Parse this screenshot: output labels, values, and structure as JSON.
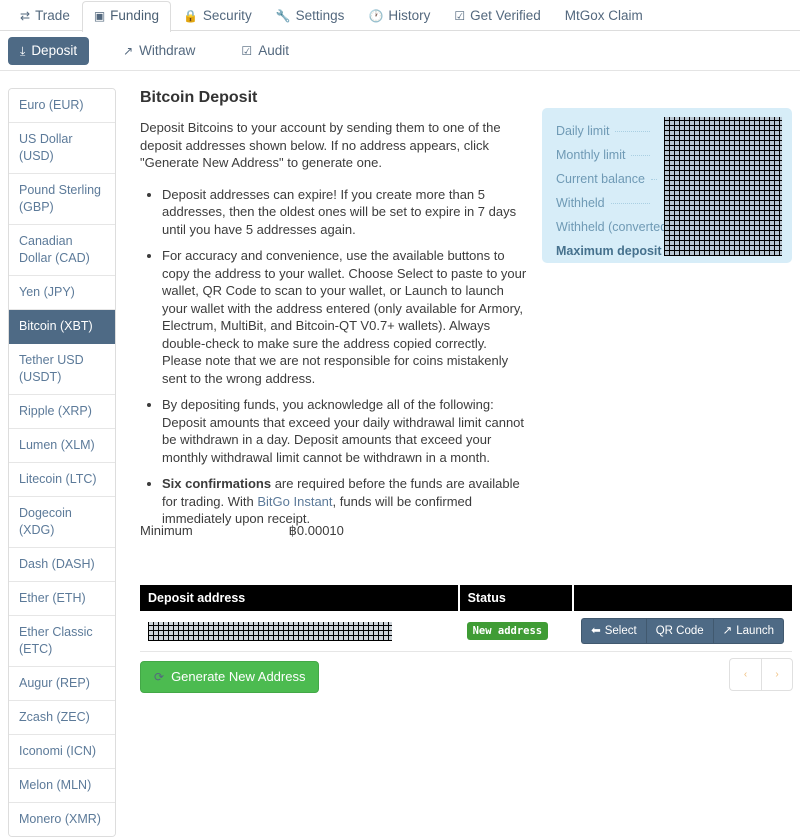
{
  "nav": {
    "tabs": [
      {
        "label": "Trade",
        "icon": "exchange-icon",
        "glyph": "⇄",
        "active": false
      },
      {
        "label": "Funding",
        "icon": "money-bill-icon",
        "glyph": "▣",
        "active": true
      },
      {
        "label": "Security",
        "icon": "lock-icon",
        "glyph": "🔒",
        "active": false
      },
      {
        "label": "Settings",
        "icon": "wrench-icon",
        "glyph": "🔧",
        "active": false
      },
      {
        "label": "History",
        "icon": "clock-icon",
        "glyph": "🕐",
        "active": false
      },
      {
        "label": "Get Verified",
        "icon": "check-square-icon",
        "glyph": "☑",
        "active": false
      },
      {
        "label": "MtGox Claim",
        "icon": "none",
        "glyph": "",
        "active": false
      }
    ]
  },
  "subnav": {
    "tabs": [
      {
        "label": "Deposit",
        "icon": "download-icon",
        "glyph": "⤓",
        "active": true
      },
      {
        "label": "Withdraw",
        "icon": "external-link-icon",
        "glyph": "↗",
        "active": false
      },
      {
        "label": "Audit",
        "icon": "check-square-icon",
        "glyph": "☑",
        "active": false
      }
    ]
  },
  "sidebar": {
    "items": [
      {
        "label": "Euro (EUR)",
        "active": false
      },
      {
        "label": "US Dollar (USD)",
        "active": false
      },
      {
        "label": "Pound Sterling (GBP)",
        "active": false
      },
      {
        "label": "Canadian Dollar (CAD)",
        "active": false
      },
      {
        "label": "Yen (JPY)",
        "active": false
      },
      {
        "label": "Bitcoin (XBT)",
        "active": true
      },
      {
        "label": "Tether USD (USDT)",
        "active": false
      },
      {
        "label": "Ripple (XRP)",
        "active": false
      },
      {
        "label": "Lumen (XLM)",
        "active": false
      },
      {
        "label": "Litecoin (LTC)",
        "active": false
      },
      {
        "label": "Dogecoin (XDG)",
        "active": false
      },
      {
        "label": "Dash (DASH)",
        "active": false
      },
      {
        "label": "Ether (ETH)",
        "active": false
      },
      {
        "label": "Ether Classic (ETC)",
        "active": false
      },
      {
        "label": "Augur (REP)",
        "active": false
      },
      {
        "label": "Zcash (ZEC)",
        "active": false
      },
      {
        "label": "Iconomi (ICN)",
        "active": false
      },
      {
        "label": "Melon (MLN)",
        "active": false
      },
      {
        "label": "Monero (XMR)",
        "active": false
      }
    ]
  },
  "main": {
    "title": "Bitcoin Deposit",
    "intro": "Deposit Bitcoins to your account by sending them to one of the deposit addresses shown below. If no address appears, click \"Generate New Address\" to generate one.",
    "bullets": [
      {
        "parts": [
          {
            "text": "Deposit addresses can expire! If you create more than 5 addresses, then the oldest ones will be set to expire in 7 days until you have 5 addresses again.",
            "style": "normal"
          }
        ]
      },
      {
        "parts": [
          {
            "text": "For accuracy and convenience, use the available buttons to copy the address to your wallet. Choose Select to paste to your wallet, QR Code to scan to your wallet, or Launch to launch your wallet with the address entered (only available for Armory, Electrum, MultiBit, and Bitcoin-QT V0.7+ wallets). Always double-check to make sure the address copied correctly. Please note that we are not responsible for coins mistakenly sent to the wrong address.",
            "style": "normal"
          }
        ]
      },
      {
        "parts": [
          {
            "text": "By depositing funds, you acknowledge all of the following: Deposit amounts that exceed your daily withdrawal limit cannot be withdrawn in a day. Deposit amounts that exceed your monthly withdrawal limit cannot be withdrawn in a month.",
            "style": "normal"
          }
        ]
      },
      {
        "parts": [
          {
            "text": "Six confirmations",
            "style": "bold"
          },
          {
            "text": " are required before the funds are available for trading. With ",
            "style": "normal"
          },
          {
            "text": "BitGo Instant",
            "style": "link"
          },
          {
            "text": ", funds will be confirmed immediately upon receipt.",
            "style": "normal"
          }
        ]
      }
    ],
    "minimum_label": "Minimum",
    "minimum_value": "฿0.00010"
  },
  "limits": {
    "rows": [
      {
        "label": "Daily limit",
        "value": "",
        "masked": true,
        "strong": false
      },
      {
        "label": "Monthly limit",
        "value": "",
        "masked": true,
        "strong": false
      },
      {
        "label": "Current balance",
        "value": "",
        "masked": true,
        "strong": false
      },
      {
        "label": "Withheld",
        "value": "",
        "masked": true,
        "strong": false
      },
      {
        "label": "Withheld (converted)",
        "value": "",
        "masked": true,
        "strong": false
      },
      {
        "label": "Maximum deposit",
        "value": "",
        "masked": true,
        "strong": true
      }
    ]
  },
  "table": {
    "columns": [
      "Deposit address",
      "Status",
      ""
    ],
    "rows": [
      {
        "address": "",
        "address_masked": true,
        "status": "New address",
        "actions": [
          {
            "label": "Select",
            "icon": "arrow-left-icon",
            "glyph": "⬅"
          },
          {
            "label": "QR Code",
            "icon": "qr-code-icon",
            "glyph": ""
          },
          {
            "label": "Launch",
            "icon": "external-link-icon",
            "glyph": "↗"
          }
        ]
      }
    ]
  },
  "footer": {
    "generate_label": "Generate New Address",
    "generate_icon": "refresh-icon",
    "generate_glyph": "⟳",
    "pager": [
      {
        "label": "‹",
        "name": "pagination-prev"
      },
      {
        "label": "›",
        "name": "pagination-next"
      }
    ]
  },
  "colors": {
    "slate": "#4e6a85",
    "green": "#4cbb50",
    "badge_green": "#3f9c35",
    "panel_blue": "#d7edf8",
    "link": "#5c7a99"
  }
}
